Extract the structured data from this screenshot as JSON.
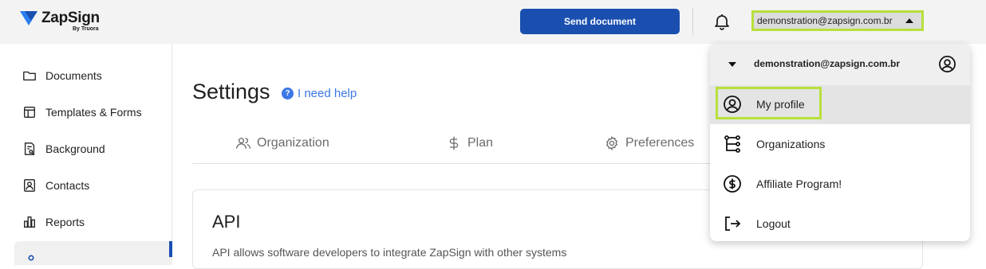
{
  "header": {
    "brand": "ZapSign",
    "brand_sub": "By Truora",
    "send_button": "Send document",
    "account_email": "demonstration@zapsign.com.br",
    "colors": {
      "primary": "#1a4fb0",
      "highlight": "#b7e03a"
    }
  },
  "sidebar": {
    "items": [
      {
        "label": "Documents",
        "icon": "folder-icon"
      },
      {
        "label": "Templates & Forms",
        "icon": "template-icon"
      },
      {
        "label": "Background",
        "icon": "background-check-icon"
      },
      {
        "label": "Contacts",
        "icon": "contact-icon"
      },
      {
        "label": "Reports",
        "icon": "bar-chart-icon"
      }
    ]
  },
  "main": {
    "title": "Settings",
    "help_link": "I need help",
    "tabs": [
      {
        "label": "Organization",
        "icon": "users-icon"
      },
      {
        "label": "Plan",
        "icon": "dollar-icon"
      },
      {
        "label": "Preferences",
        "icon": "gear-icon"
      }
    ],
    "card": {
      "title": "API",
      "text": "API allows software developers to integrate ZapSign with other systems"
    }
  },
  "dropdown": {
    "email": "demonstration@zapsign.com.br",
    "items": [
      {
        "label": "My profile",
        "icon": "user-circle-icon"
      },
      {
        "label": "Organizations",
        "icon": "org-tree-icon"
      },
      {
        "label": "Affiliate Program!",
        "icon": "dollar-circle-icon"
      },
      {
        "label": "Logout",
        "icon": "logout-icon"
      }
    ]
  }
}
